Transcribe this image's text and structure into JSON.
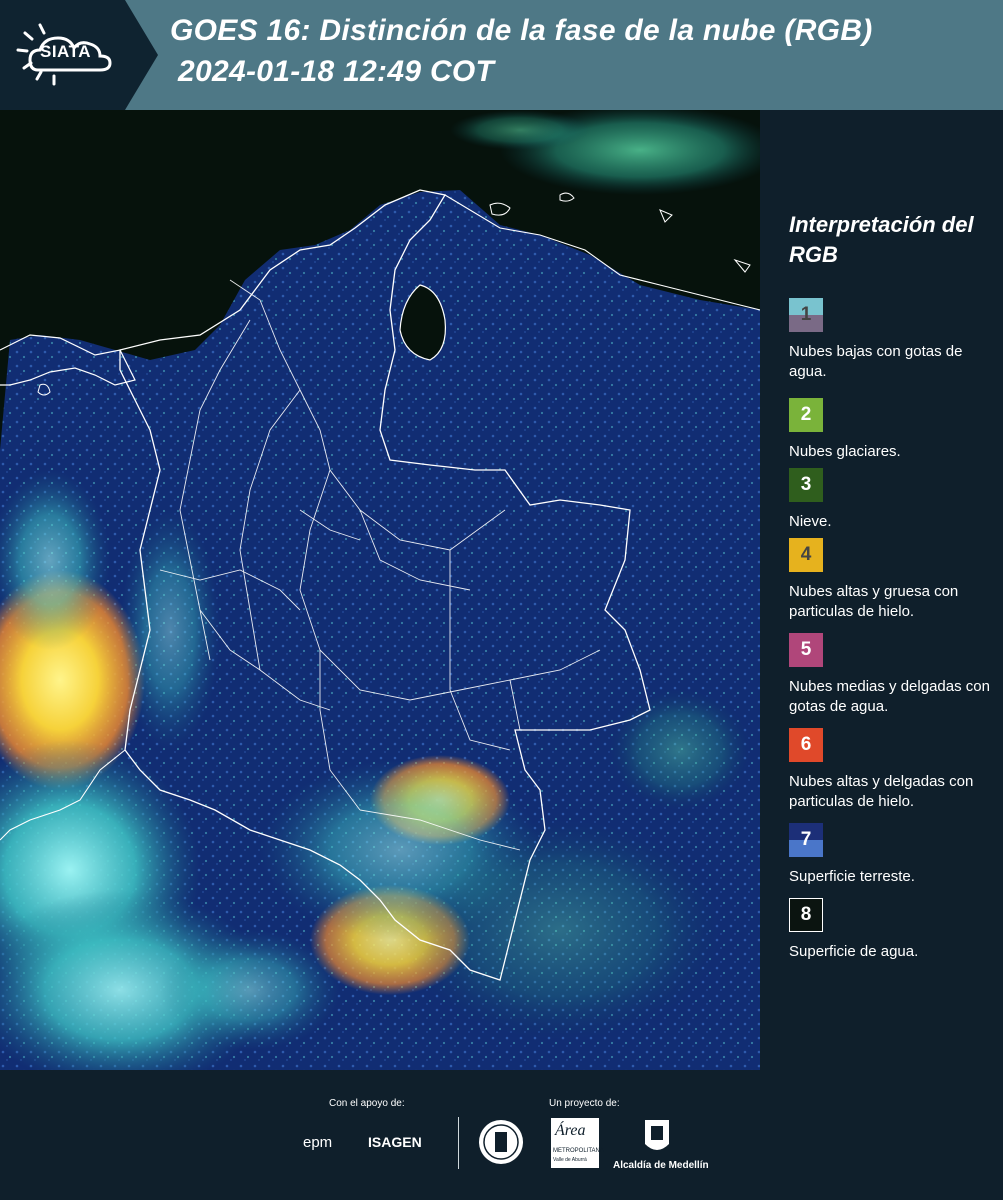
{
  "header": {
    "logo": "SIATA",
    "title": "GOES 16: Distinción de la fase de la nube (RGB)",
    "datetime": "2024-01-18 12:49 COT"
  },
  "legend": {
    "title": "Interpretación del RGB",
    "items": [
      {
        "number": "1",
        "label": "Nubes bajas con gotas de agua.",
        "color_top": "#79c3cf",
        "color_bottom": "#7a6a86",
        "text_color": "#444444"
      },
      {
        "number": "2",
        "label": "Nubes glaciares.",
        "color_top": "#7ab33a",
        "color_bottom": "#7ab33a",
        "text_color": "#ffffff"
      },
      {
        "number": "3",
        "label": "Nieve.",
        "color_top": "#2f5e1d",
        "color_bottom": "#2f5e1d",
        "text_color": "#ffffff"
      },
      {
        "number": "4",
        "label": "Nubes altas y gruesa con particulas de hielo.",
        "color_top": "#e6b21e",
        "color_bottom": "#e6b21e",
        "text_color": "#444444"
      },
      {
        "number": "5",
        "label": "Nubes medias y delgadas con gotas de agua.",
        "color_top": "#b0467a",
        "color_bottom": "#b0467a",
        "text_color": "#ffffff"
      },
      {
        "number": "6",
        "label": "Nubes altas y delgadas con particulas de hielo.",
        "color_top": "#e0492a",
        "color_bottom": "#e0492a",
        "text_color": "#ffffff"
      },
      {
        "number": "7",
        "label": "Superficie terreste.",
        "color_top": "#1c2f78",
        "color_bottom": "#4a76c9",
        "text_color": "#ffffff"
      },
      {
        "number": "8",
        "label": "Superficie de agua.",
        "color_top": "#0b1410",
        "color_bottom": "#0b1410",
        "text_color": "#ffffff"
      }
    ]
  },
  "footer": {
    "support_label": "Con el apoyo de:",
    "project_label": "Un proyecto de:",
    "sponsors": [
      "epm",
      "ISAGEN"
    ],
    "partners": [
      "Área Metropolitana Valle de Aburrá",
      "Alcaldía de Medellín"
    ],
    "metro_text": "METROPOLITANA",
    "metro_sub": "Valle de Aburrá",
    "alcaldia": "Alcaldía de Medellín"
  },
  "colors": {
    "header_bg": "#4e7886",
    "page_bg": "#0f1f2b",
    "land": "#0e2a6b",
    "ocean": "#06120c",
    "cloud_cyan": "#4fd0c8",
    "cloud_yellow": "#f2d63a",
    "cloud_orange": "#f08b2e"
  }
}
